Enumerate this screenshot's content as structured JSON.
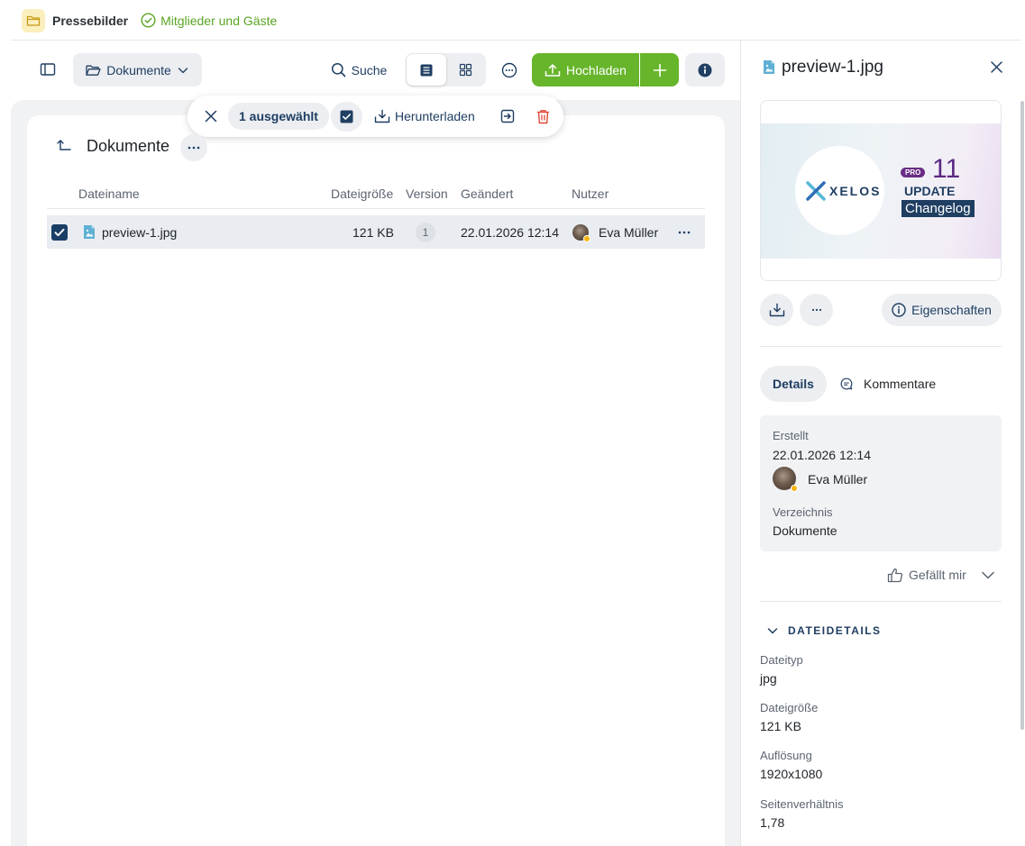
{
  "topbar": {
    "space_name": "Pressebilder",
    "members_label": "Mitglieder und Gäste"
  },
  "toolbar": {
    "folder_label": "Dokumente",
    "search_label": "Suche",
    "upload_label": "Hochladen"
  },
  "selection": {
    "count_label": "1 ausgewählt",
    "download_label": "Herunterladen"
  },
  "folder": {
    "title": "Dokumente"
  },
  "table": {
    "headers": {
      "name": "Dateiname",
      "size": "Dateigröße",
      "version": "Version",
      "changed": "Geändert",
      "user": "Nutzer"
    },
    "rows": [
      {
        "name": "preview-1.jpg",
        "size": "121 KB",
        "version": "1",
        "changed": "22.01.2026 12:14",
        "user": "Eva Müller",
        "selected": true
      }
    ]
  },
  "panel": {
    "title": "preview-1.jpg",
    "preview": {
      "brand": "XELOS",
      "badge": "PRO",
      "number": "11",
      "update": "UPDATE",
      "changelog": "Changelog"
    },
    "properties_label": "Eigenschaften",
    "tabs": {
      "details": "Details",
      "comments": "Kommentare"
    },
    "details": {
      "created_label": "Erstellt",
      "created_value": "22.01.2026 12:14",
      "created_user": "Eva Müller",
      "directory_label": "Verzeichnis",
      "directory_value": "Dokumente"
    },
    "like_label": "Gefällt mir",
    "file_details": {
      "title": "DATEIDETAILS",
      "type_label": "Dateityp",
      "type_value": "jpg",
      "size_label": "Dateigröße",
      "size_value": "121 KB",
      "resolution_label": "Auflösung",
      "resolution_value": "1920x1080",
      "ratio_label": "Seitenverhältnis",
      "ratio_value": "1,78"
    }
  },
  "colors": {
    "accent": "#1f3e62",
    "green": "#67b52b",
    "danger": "#e04a3a",
    "avatar_status": "#f5b40f"
  }
}
